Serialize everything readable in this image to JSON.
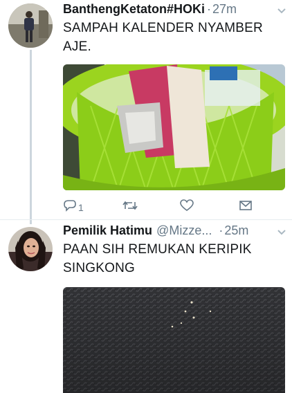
{
  "tweets": [
    {
      "name": "BanthengKetaton#HOKi",
      "handle": "",
      "dot": "·",
      "time": "27m",
      "text": "SAMPAH KALENDER NYAMBER AJE.",
      "reply_count": "1",
      "icons": [
        "reply-icon",
        "retweet-icon",
        "like-icon",
        "message-icon",
        "chevron-down-icon"
      ]
    },
    {
      "name": "Pemilik Hatimu",
      "handle": "@Mizze...",
      "dot": "·",
      "time": "25m",
      "text": "PAAN SIH REMUKAN KERIPIK SINGKONG",
      "icons": [
        "chevron-down-icon"
      ]
    }
  ],
  "colors": {
    "text": "#14171a",
    "secondary": "#657786",
    "thread_line": "#ccd6dd",
    "basket_green": "#8ed11a"
  }
}
